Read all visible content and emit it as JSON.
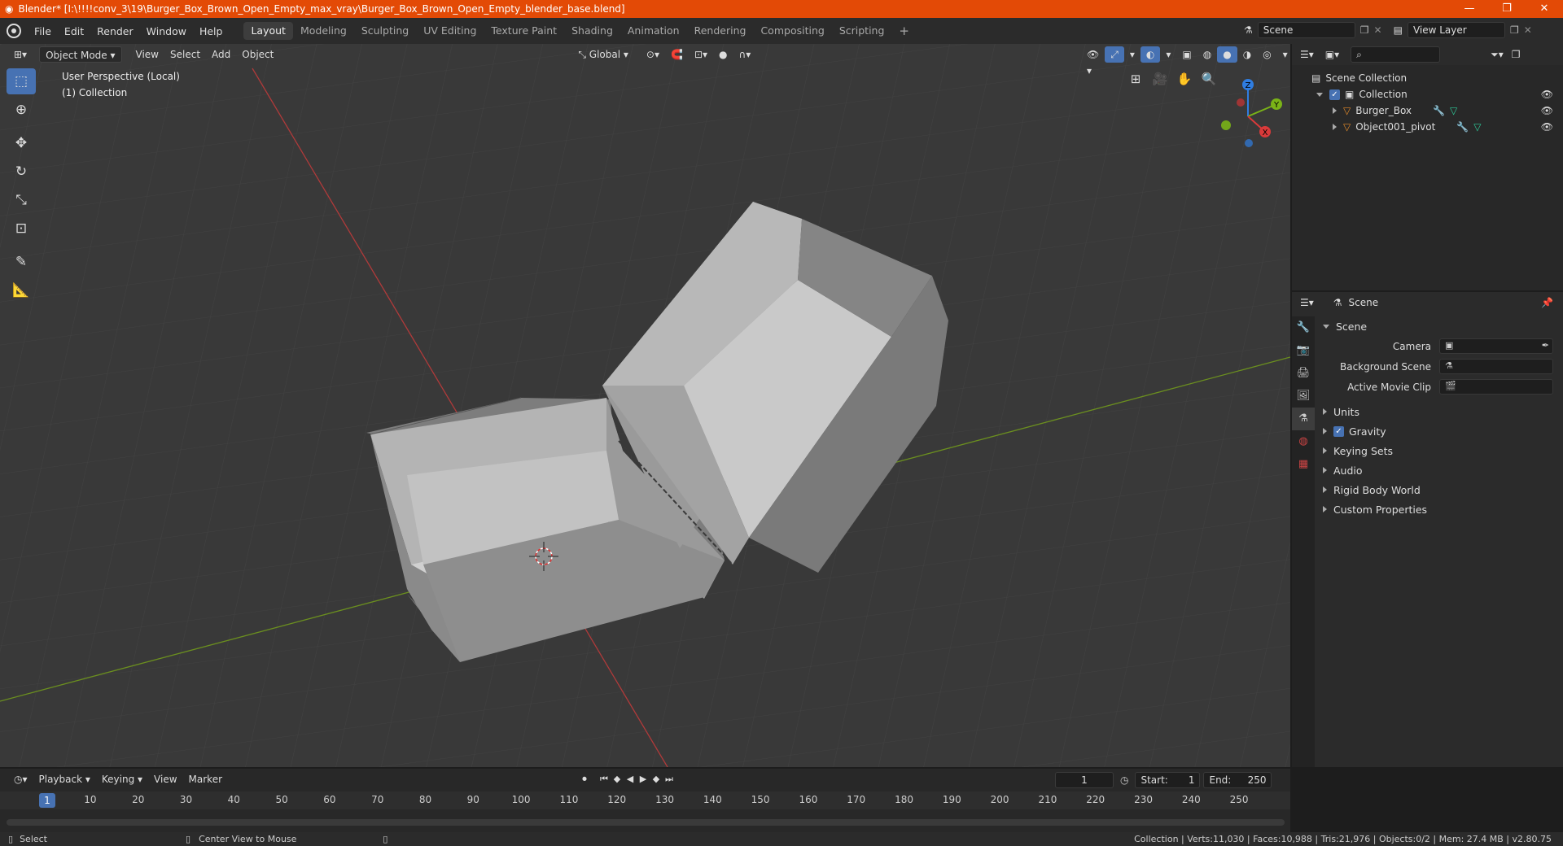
{
  "window": {
    "title": "Blender* [I:\\!!!!conv_3\\19\\Burger_Box_Brown_Open_Empty_max_vray\\Burger_Box_Brown_Open_Empty_blender_base.blend]",
    "controls": [
      "—",
      "❐",
      "✕"
    ]
  },
  "menu": [
    "File",
    "Edit",
    "Render",
    "Window",
    "Help"
  ],
  "workspaces": [
    "Layout",
    "Modeling",
    "Sculpting",
    "UV Editing",
    "Texture Paint",
    "Shading",
    "Animation",
    "Rendering",
    "Compositing",
    "Scripting"
  ],
  "active_workspace": "Layout",
  "scene_field": "Scene",
  "view_layer_field": "View Layer",
  "viewport": {
    "mode": "Object Mode",
    "menus": [
      "View",
      "Select",
      "Add",
      "Object"
    ],
    "transform": "Global",
    "info_line1": "User Perspective (Local)",
    "info_line2": "(1) Collection",
    "gizmo_axes": [
      "Z",
      "Y",
      "X"
    ]
  },
  "outliner": {
    "root": "Scene Collection",
    "collection": "Collection",
    "objects": [
      "Burger_Box",
      "Object001_pivot"
    ]
  },
  "properties": {
    "header": "Scene",
    "panel": "Scene",
    "fields": [
      "Camera",
      "Background Scene",
      "Active Movie Clip"
    ],
    "subpanels": [
      "Units",
      "Gravity",
      "Keying Sets",
      "Audio",
      "Rigid Body World",
      "Custom Properties"
    ]
  },
  "timeline": {
    "menus": [
      "Playback",
      "Keying",
      "View",
      "Marker"
    ],
    "current_frame": "1",
    "start_label": "Start:",
    "start": "1",
    "end_label": "End:",
    "end": "250",
    "ticks": [
      "10",
      "20",
      "30",
      "40",
      "50",
      "60",
      "70",
      "80",
      "90",
      "100",
      "110",
      "120",
      "130",
      "140",
      "150",
      "160",
      "170",
      "180",
      "190",
      "200",
      "210",
      "220",
      "230",
      "240",
      "250"
    ]
  },
  "status": {
    "left": "Select",
    "middle": "Center View to Mouse",
    "right": "Collection | Verts:11,030 | Faces:10,988 | Tris:21,976 | Objects:0/2 | Mem: 27.4 MB | v2.80.75"
  },
  "colors": {
    "titlebar": "#e34a06",
    "accent": "#4772b3",
    "x_axis": "#d93a3a",
    "y_axis": "#7ab317",
    "z_axis": "#2f7de1"
  }
}
